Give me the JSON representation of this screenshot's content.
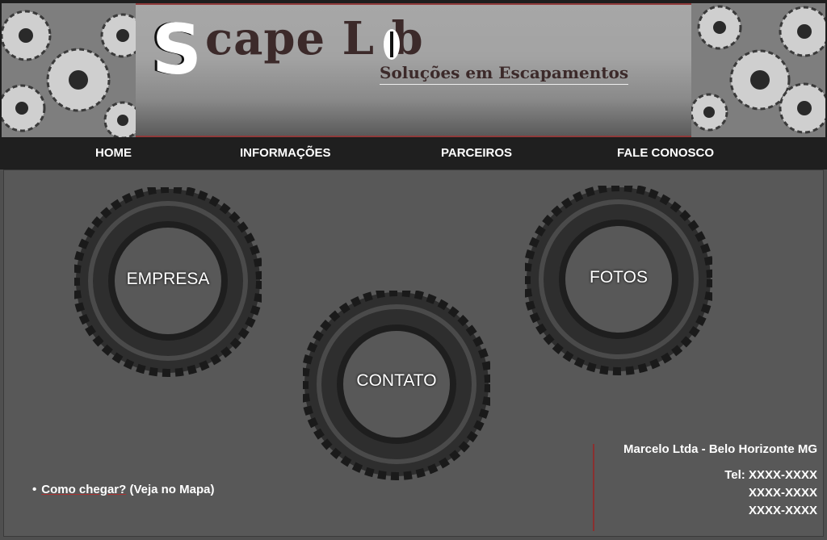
{
  "header": {
    "logo_s": "S",
    "logo_rest": "cape L  b",
    "tagline": "Soluções em Escapamentos"
  },
  "nav": {
    "items": [
      {
        "label": "HOME"
      },
      {
        "label": "INFORMAÇÕES"
      },
      {
        "label": "PARCEIROS"
      },
      {
        "label": "FALE CONOSCO"
      }
    ]
  },
  "tiles": [
    {
      "label": "EMPRESA"
    },
    {
      "label": "CONTATO"
    },
    {
      "label": "FOTOS"
    }
  ],
  "footer": {
    "bullet": "•",
    "map_link_underlined": "Como chegar?",
    "map_link_rest": " (Veja no Mapa)",
    "company": "Marcelo Ltda - Belo Horizonte MG",
    "phones": [
      "Tel: XXXX-XXXX",
      "XXXX-XXXX",
      "XXXX-XXXX"
    ]
  },
  "colors": {
    "accent_line": "#8f3a3a",
    "logo_text": "#3c2a2a",
    "nav_bg": "#1f1f1f",
    "main_bg": "#585858"
  }
}
